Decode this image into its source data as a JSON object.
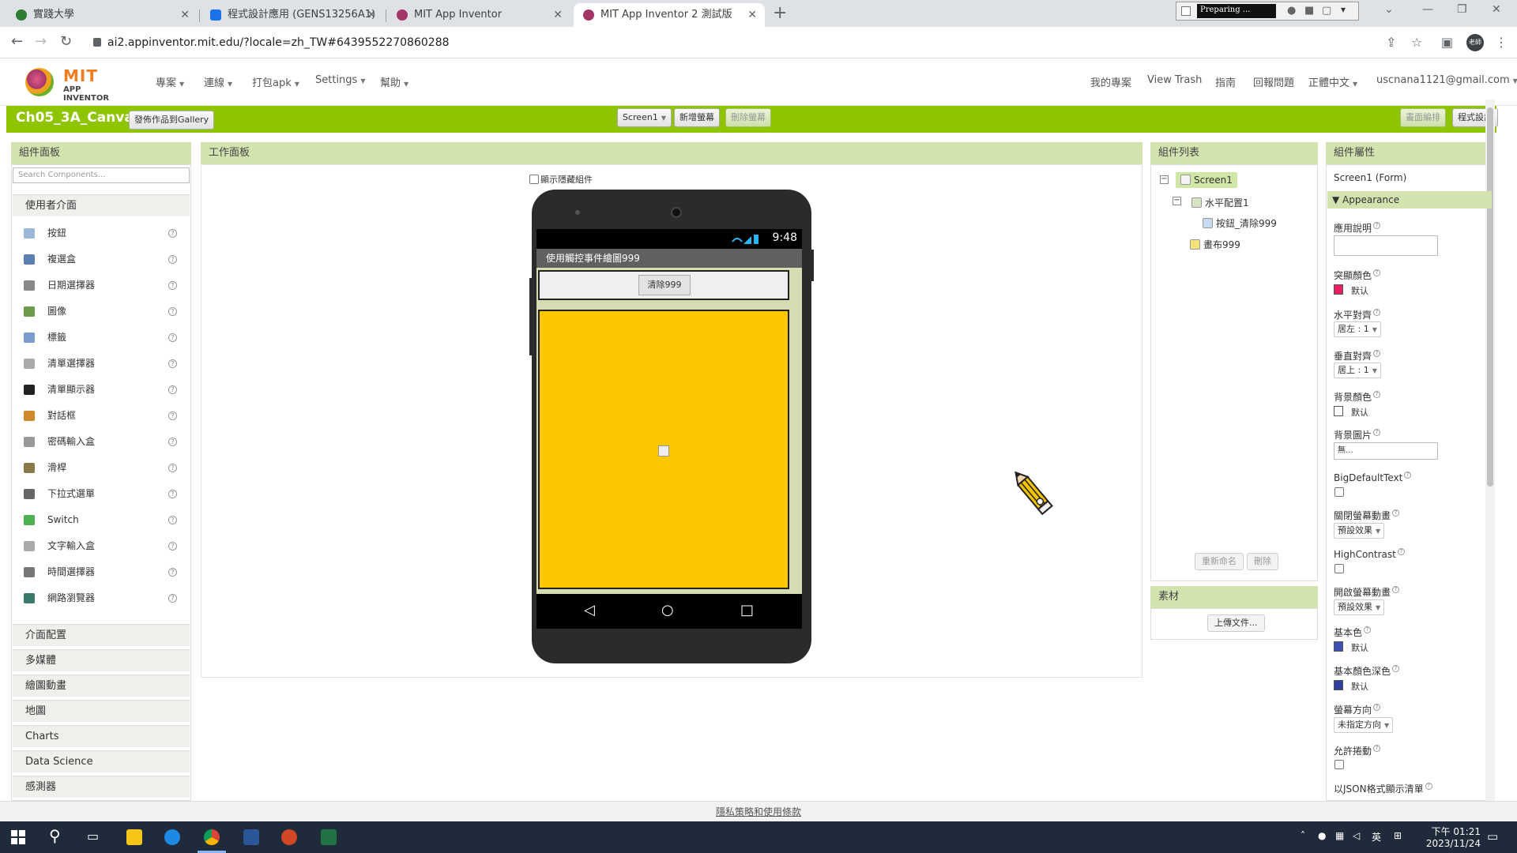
{
  "browser": {
    "tabs": [
      {
        "title": "實踐大學",
        "color": "#2e7d32"
      },
      {
        "title": "程式設計應用 (GENS13256A1)",
        "color": "#1a73e8"
      },
      {
        "title": "MIT App Inventor",
        "color": "#a43667"
      },
      {
        "title": "MIT App Inventor 2 測試版",
        "color": "#a43667"
      }
    ],
    "recorder_text": "Preparing ...",
    "url": "ai2.appinventor.mit.edu/?locale=zh_TW#6439552270860288",
    "avatar_text": "老師"
  },
  "app": {
    "logo_title": "MIT",
    "logo_subtitle": "APP INVENTOR",
    "menu_left": [
      "專案",
      "連線",
      "打包apk",
      "Settings",
      "幫助"
    ],
    "menu_right": [
      "我的專案",
      "View Trash",
      "指南",
      "回報問題",
      "正體中文",
      "uscnana1121@gmail.com"
    ]
  },
  "project": {
    "name": "Ch05_3A_Canvas",
    "gallery_button": "發佈作品到Gallery",
    "screen_select": "Screen1",
    "add_screen": "新增螢幕",
    "remove_screen": "刪除螢幕",
    "designer_button": "畫面編排",
    "blocks_button": "程式設計"
  },
  "palette": {
    "title": "組件面板",
    "search_placeholder": "Search Components...",
    "category_open": "使用者介面",
    "items": [
      {
        "label": "按鈕",
        "icon": "button-icon",
        "color": "#9bb6d6"
      },
      {
        "label": "複選盒",
        "icon": "checkbox-icon",
        "color": "#5a7fb0"
      },
      {
        "label": "日期選擇器",
        "icon": "date-picker-icon",
        "color": "#888888"
      },
      {
        "label": "圖像",
        "icon": "image-icon",
        "color": "#6a9a4a"
      },
      {
        "label": "標籤",
        "icon": "label-icon",
        "color": "#7a9ccc"
      },
      {
        "label": "清單選擇器",
        "icon": "list-picker-icon",
        "color": "#aaaaaa"
      },
      {
        "label": "清單顯示器",
        "icon": "list-view-icon",
        "color": "#222222"
      },
      {
        "label": "對話框",
        "icon": "notifier-icon",
        "color": "#d08a2a"
      },
      {
        "label": "密碼輸入盒",
        "icon": "password-icon",
        "color": "#999999"
      },
      {
        "label": "滑桿",
        "icon": "slider-icon",
        "color": "#8a7a4a"
      },
      {
        "label": "下拉式選單",
        "icon": "spinner-icon",
        "color": "#666666"
      },
      {
        "label": "Switch",
        "icon": "switch-icon",
        "color": "#4caf50"
      },
      {
        "label": "文字輸入盒",
        "icon": "textbox-icon",
        "color": "#aaaaaa"
      },
      {
        "label": "時間選擇器",
        "icon": "time-picker-icon",
        "color": "#777777"
      },
      {
        "label": "網路瀏覽器",
        "icon": "web-viewer-icon",
        "color": "#3a7a6a"
      }
    ],
    "categories": [
      "介面配置",
      "多媒體",
      "繪圖動畫",
      "地圖",
      "Charts",
      "Data Science",
      "感測器"
    ]
  },
  "viewer": {
    "title": "工作面板",
    "show_hidden": "顯示隱藏組件",
    "status_time": "9:48",
    "screen_title": "使用觸控事件繪圖999",
    "clear_button": "清除999"
  },
  "components": {
    "title": "組件列表",
    "tree": [
      "Screen1",
      "水平配置1",
      "按鈕_清除999",
      "畫布999"
    ],
    "rename": "重新命名",
    "delete": "刪除",
    "media_title": "素材",
    "upload": "上傳文件..."
  },
  "properties": {
    "title": "組件屬性",
    "component": "Screen1 (Form)",
    "section": "Appearance",
    "app_description": "應用說明",
    "accent_color": "突顯顏色",
    "accent_value": "默认",
    "accent_swatch": "#e91e63",
    "align_h": "水平對齊",
    "align_h_value": "居左 : 1",
    "align_v": "垂直對齊",
    "align_v_value": "居上 : 1",
    "bg_color": "背景顏色",
    "bg_value": "默认",
    "bg_swatch": "#ffffff",
    "bg_image": "背景圖片",
    "bg_image_value": "無...",
    "big_default_text": "BigDefaultText",
    "close_anim": "關閉螢幕動畫",
    "close_anim_value": "預設效果",
    "high_contrast": "HighContrast",
    "open_anim": "開啟螢幕動畫",
    "open_anim_value": "預設效果",
    "primary": "基本色",
    "primary_value": "默认",
    "primary_swatch": "#3f51b5",
    "primary_dark": "基本顏色深色",
    "primary_dark_value": "默认",
    "primary_dark_swatch": "#303f9f",
    "orientation": "螢幕方向",
    "orientation_value": "未指定方向",
    "scrollable": "允許捲動",
    "show_list_json": "以JSON格式顯示清單"
  },
  "footer": {
    "privacy": "隱私策略和使用條款"
  },
  "taskbar": {
    "time": "下午 01:21",
    "date": "2023/11/24",
    "ime": "英"
  }
}
